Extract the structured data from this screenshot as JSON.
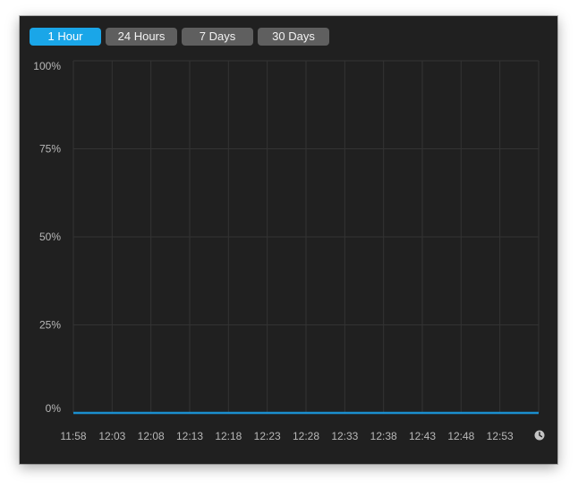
{
  "time_ranges": [
    {
      "label": "1 Hour",
      "active": true
    },
    {
      "label": "24 Hours",
      "active": false
    },
    {
      "label": "7 Days",
      "active": false
    },
    {
      "label": "30 Days",
      "active": false
    }
  ],
  "colors": {
    "background": "#202020",
    "accent": "#1aa6e8",
    "button": "#5f5f5f",
    "grid": "#333333",
    "series": "#1b8fcf"
  },
  "icons": {
    "time_axis": "clock-icon"
  },
  "chart_data": {
    "type": "line",
    "title": "",
    "xlabel": "",
    "ylabel": "",
    "y_ticks": [
      "100%",
      "75%",
      "50%",
      "25%",
      "0%"
    ],
    "y_tick_values": [
      100,
      75,
      50,
      25,
      0
    ],
    "ylim": [
      0,
      100
    ],
    "x_ticks": [
      "11:58",
      "12:03",
      "12:08",
      "12:13",
      "12:18",
      "12:23",
      "12:28",
      "12:33",
      "12:38",
      "12:43",
      "12:48",
      "12:53"
    ],
    "xlim": [
      "11:58",
      "12:58"
    ],
    "grid": true,
    "series": [
      {
        "x": [
          "11:58",
          "12:58"
        ],
        "values": [
          0,
          0
        ]
      }
    ]
  }
}
